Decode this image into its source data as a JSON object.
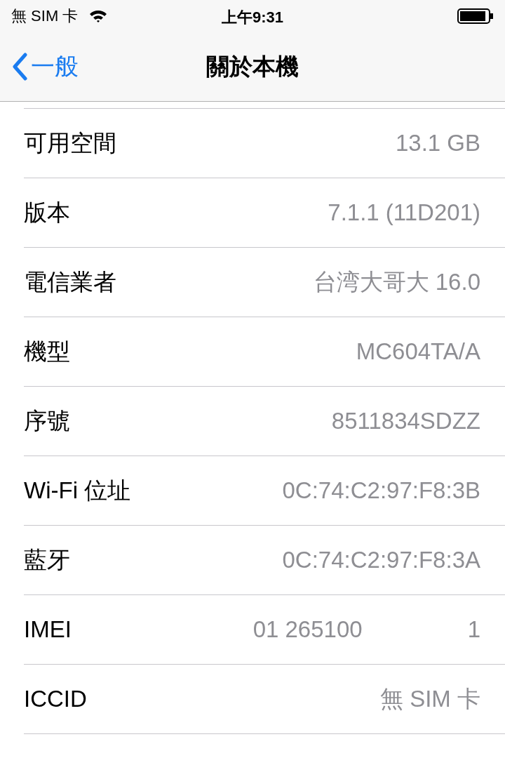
{
  "status_bar": {
    "carrier": "無 SIM 卡",
    "time": "上午9:31"
  },
  "nav": {
    "back": "一般",
    "title": "關於本機"
  },
  "rows": [
    {
      "kind": "plain",
      "label": "可用空間",
      "value": "13.1 GB"
    },
    {
      "kind": "plain",
      "label": "版本",
      "value": "7.1.1 (11D201)"
    },
    {
      "kind": "plain",
      "label": "電信業者",
      "value": "台湾大哥大 16.0"
    },
    {
      "kind": "plain",
      "label": "機型",
      "value": "MC604TA/A"
    },
    {
      "kind": "plain",
      "label": "序號",
      "value": "8511834SDZZ"
    },
    {
      "kind": "plain",
      "label": "Wi-Fi 位址",
      "value": "0C:74:C2:97:F8:3B"
    },
    {
      "kind": "plain",
      "label": "藍牙",
      "value": "0C:74:C2:97:F8:3A"
    },
    {
      "kind": "split",
      "label": "IMEI",
      "values": [
        "01 265100",
        "1"
      ]
    },
    {
      "kind": "plain",
      "label": "ICCID",
      "value": "無 SIM 卡"
    }
  ]
}
